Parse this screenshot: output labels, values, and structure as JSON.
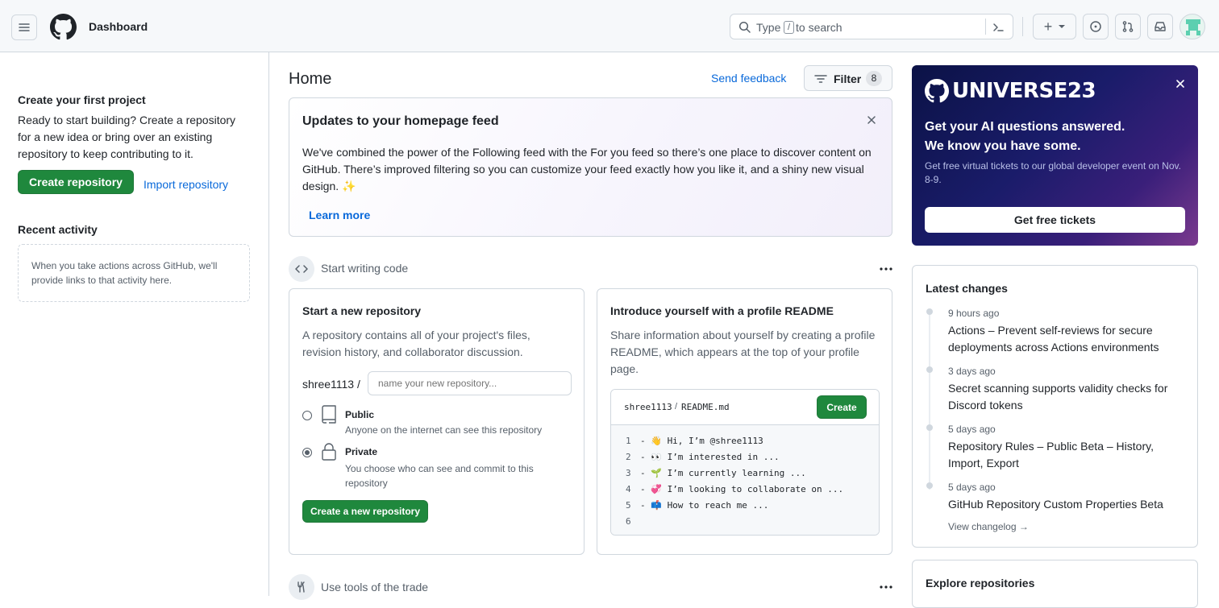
{
  "header": {
    "title": "Dashboard",
    "search_prefix": "Type",
    "search_key": "/",
    "search_suffix": "to search",
    "new_plus": "+"
  },
  "left": {
    "project_heading": "Create your first project",
    "project_text": "Ready to start building? Create a repository for a new idea or bring over an existing repository to keep contributing to it.",
    "create_repo_btn": "Create repository",
    "import_repo_link": "Import repository",
    "recent_heading": "Recent activity",
    "recent_empty": "When you take actions across GitHub, we'll provide links to that activity here."
  },
  "main": {
    "home_title": "Home",
    "send_feedback": "Send feedback",
    "filter_label": "Filter",
    "filter_count": "8",
    "updates": {
      "title": "Updates to your homepage feed",
      "body": "We've combined the power of the Following feed with the For you feed so there’s one place to discover content on GitHub. There’s improved filtering so you can customize your feed exactly how you like it, and a shiny new visual design. ✨",
      "learn_more": "Learn more"
    },
    "start_writing": "Start writing code",
    "new_repo": {
      "title": "Start a new repository",
      "desc": "A repository contains all of your project's files, revision history, and collaborator discussion.",
      "owner": "shree1113 /",
      "name_placeholder": "name your new repository...",
      "public_label": "Public",
      "public_desc": "Anyone on the internet can see this repository",
      "private_label": "Private",
      "private_desc": "You choose who can see and commit to this repository",
      "create_btn": "Create a new repository"
    },
    "readme": {
      "title": "Introduce yourself with a profile README",
      "desc": "Share information about yourself by creating a profile README, which appears at the top of your profile page.",
      "path_user": "shree1113",
      "path_sep": "/",
      "path_file": "README.md",
      "create_btn": "Create",
      "lines": [
        {
          "num": "1",
          "text": "- 👋 Hi, I’m @shree1113"
        },
        {
          "num": "2",
          "text": "- 👀 I’m interested in ..."
        },
        {
          "num": "3",
          "text": "- 🌱 I’m currently learning ..."
        },
        {
          "num": "4",
          "text": "- 💞️ I’m looking to collaborate on ..."
        },
        {
          "num": "5",
          "text": "- 📫 How to reach me ..."
        },
        {
          "num": "6",
          "text": ""
        }
      ]
    },
    "tools_heading": "Use tools of the trade"
  },
  "right": {
    "universe": {
      "logo": "UNIVERSE23",
      "headline1": "Get your AI questions answered.",
      "headline2": "We know you have some.",
      "sub": "Get free virtual tickets to our global developer event on Nov. 8-9.",
      "btn": "Get free tickets"
    },
    "latest": {
      "heading": "Latest changes",
      "items": [
        {
          "time": "9 hours ago",
          "title": "Actions – Prevent self-reviews for secure deployments across Actions environments"
        },
        {
          "time": "3 days ago",
          "title": "Secret scanning supports validity checks for Discord tokens"
        },
        {
          "time": "5 days ago",
          "title": "Repository Rules – Public Beta – History, Import, Export"
        },
        {
          "time": "5 days ago",
          "title": "GitHub Repository Custom Properties Beta"
        }
      ],
      "view_changelog": "View changelog →"
    },
    "explore_heading": "Explore repositories"
  },
  "colors": {
    "primary_green": "#1f883d",
    "link_blue": "#0969da",
    "universe_bg": "#0d1450"
  }
}
